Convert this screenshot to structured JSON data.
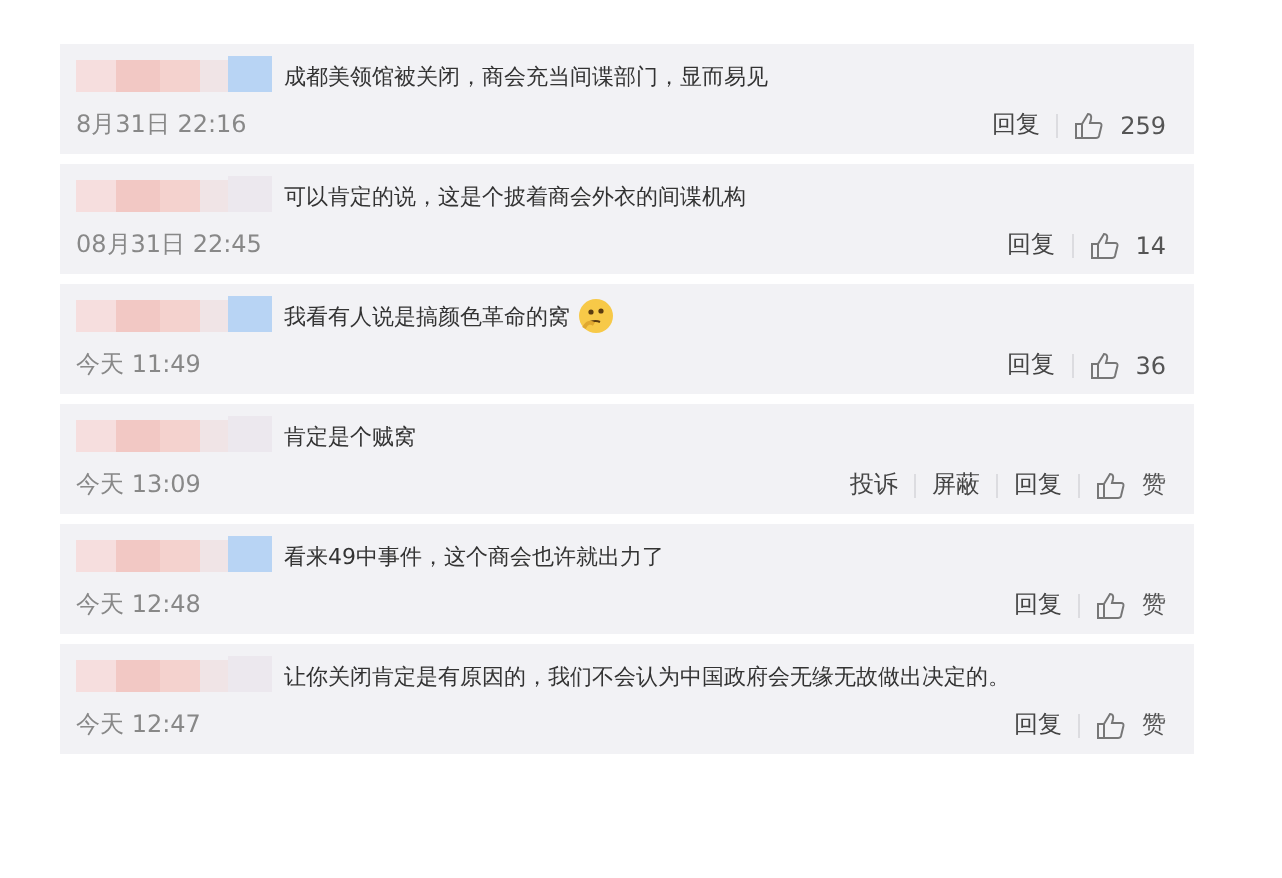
{
  "comments": [
    {
      "text": "成都美领馆被关闭，商会充当间谍部门，显而易见",
      "has_emoji": false,
      "time": "8月31日 22:16",
      "actions": [
        "回复"
      ],
      "likes": "259"
    },
    {
      "text": "可以肯定的说，这是个披着商会外衣的间谍机构",
      "has_emoji": false,
      "time": "08月31日 22:45",
      "actions": [
        "回复"
      ],
      "likes": "14"
    },
    {
      "text": "我看有人说是搞颜色革命的窝",
      "has_emoji": true,
      "time": "今天 11:49",
      "actions": [
        "回复"
      ],
      "likes": "36"
    },
    {
      "text": "肯定是个贼窝",
      "has_emoji": false,
      "time": "今天 13:09",
      "actions": [
        "投诉",
        "屏蔽",
        "回复"
      ],
      "likes": "赞"
    },
    {
      "text": "看来49中事件，这个商会也许就出力了",
      "has_emoji": false,
      "time": "今天 12:48",
      "actions": [
        "回复"
      ],
      "likes": "赞"
    },
    {
      "text": "让你关闭肯定是有原因的，我们不会认为中国政府会无缘无故做出决定的。",
      "has_emoji": false,
      "time": "今天 12:47",
      "actions": [
        "回复"
      ],
      "likes": "赞"
    }
  ]
}
